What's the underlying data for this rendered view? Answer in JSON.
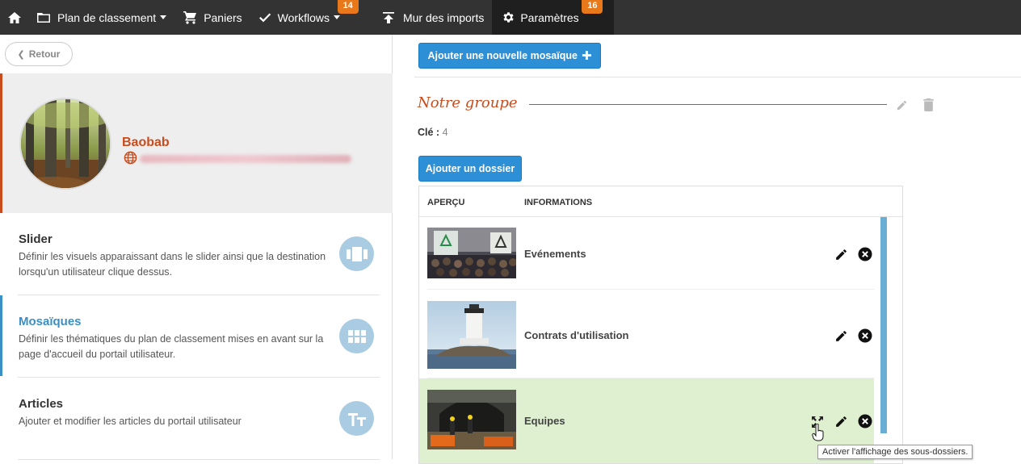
{
  "nav": {
    "items": [
      {
        "label": "Plan de classement",
        "icon": "folder-icon",
        "caret": true
      },
      {
        "label": "Paniers",
        "icon": "cart-icon"
      },
      {
        "label": "Workflows",
        "icon": "check-icon",
        "caret": true,
        "badge": "14"
      },
      {
        "label": "Mur des imports",
        "icon": "upload-icon"
      },
      {
        "label": "Paramètres",
        "icon": "gear-icon",
        "badge": "16",
        "active": true
      }
    ]
  },
  "left": {
    "back_label": "Retour",
    "org_name": "Baobab",
    "sections": [
      {
        "title": "Slider",
        "desc": "Définir les visuels apparaissant dans le slider ainsi que la destination lorsqu'un utilisateur clique dessus.",
        "icon": "slider-icon"
      },
      {
        "title": "Mosaïques",
        "desc": "Définir les thématiques du plan de classement mises en avant sur la page d'accueil du portail utilisateur.",
        "icon": "grid-icon",
        "active": true
      },
      {
        "title": "Articles",
        "desc": "Ajouter et modifier les articles du portail utilisateur",
        "icon": "text-icon"
      }
    ]
  },
  "main": {
    "add_mosaic_label": "Ajouter une nouvelle mosaïque",
    "group_title": "Notre groupe",
    "key_label": "Clé :",
    "key_value": "4",
    "add_folder_label": "Ajouter un dossier",
    "table": {
      "headers": [
        "APERÇU",
        "INFORMATIONS"
      ],
      "rows": [
        {
          "name": "Evénements"
        },
        {
          "name": "Contrats d'utilisation"
        },
        {
          "name": "Equipes",
          "highlighted": true
        }
      ]
    },
    "tooltip": "Activer l'affichage des sous-dossiers."
  },
  "colors": {
    "accent": "#c94c1c",
    "primary": "#2d8fd5",
    "topbar": "#333333",
    "badge": "#e8781a",
    "highlight_row": "#dff0d0"
  }
}
